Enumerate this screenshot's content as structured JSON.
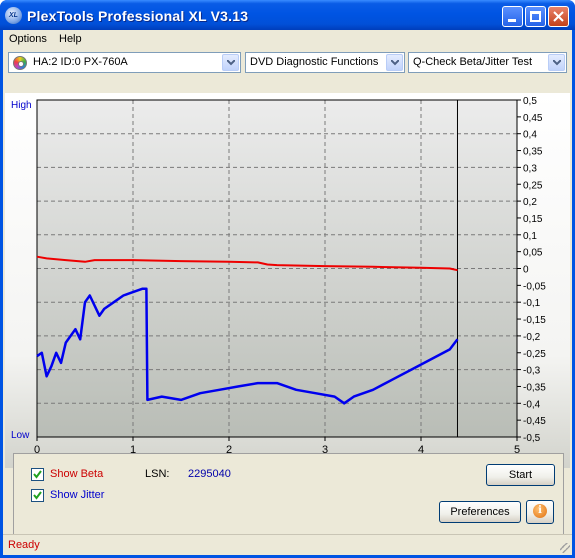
{
  "window": {
    "title": "PlexTools Professional XL V3.13",
    "icon_text": "XL"
  },
  "menu": [
    "Options",
    "Help"
  ],
  "toolbar": {
    "drive": "HA:2 ID:0  PX-760A",
    "function": "DVD Diagnostic Functions",
    "test": "Q-Check Beta/Jitter Test"
  },
  "chart_axis_labels": {
    "high": "High",
    "low": "Low"
  },
  "chart_data": {
    "type": "line",
    "xlim": [
      0,
      5
    ],
    "x_ticks": [
      "0",
      "1",
      "2",
      "3",
      "4",
      "5"
    ],
    "ylim_right": [
      -0.5,
      0.5
    ],
    "y_ticks_right": [
      "0,5",
      "0,45",
      "0,4",
      "0,35",
      "0,3",
      "0,25",
      "0,2",
      "0,15",
      "0,1",
      "0,05",
      "0",
      "-0,05",
      "-0,1",
      "-0,15",
      "-0,2",
      "-0,25",
      "-0,3",
      "-0,35",
      "-0,4",
      "-0,45",
      "-0,5"
    ],
    "grid": true,
    "marker_x": 4.38,
    "series": [
      {
        "color": "#ee0000",
        "x": [
          0,
          0.1,
          0.3,
          0.5,
          0.6,
          0.8,
          1.0,
          1.5,
          2.0,
          2.3,
          2.4,
          2.5,
          3.0,
          3.5,
          4.0,
          4.3,
          4.38
        ],
        "y": [
          0.035,
          0.03,
          0.025,
          0.02,
          0.025,
          0.025,
          0.025,
          0.022,
          0.02,
          0.018,
          0.012,
          0.01,
          0.007,
          0.005,
          0.002,
          0.0,
          -0.005
        ]
      },
      {
        "color": "#0000ee",
        "x": [
          0,
          0.05,
          0.1,
          0.15,
          0.2,
          0.25,
          0.3,
          0.4,
          0.45,
          0.5,
          0.55,
          0.6,
          0.65,
          0.7,
          0.8,
          0.9,
          1.0,
          1.1,
          1.14,
          1.15,
          1.3,
          1.5,
          1.7,
          1.9,
          2.1,
          2.3,
          2.5,
          2.7,
          2.9,
          3.1,
          3.2,
          3.3,
          3.5,
          3.7,
          3.9,
          4.1,
          4.3,
          4.38
        ],
        "y": [
          -0.26,
          -0.25,
          -0.32,
          -0.29,
          -0.25,
          -0.28,
          -0.22,
          -0.18,
          -0.21,
          -0.1,
          -0.08,
          -0.11,
          -0.14,
          -0.12,
          -0.1,
          -0.08,
          -0.07,
          -0.06,
          -0.06,
          -0.39,
          -0.38,
          -0.39,
          -0.37,
          -0.36,
          -0.35,
          -0.34,
          -0.34,
          -0.36,
          -0.37,
          -0.38,
          -0.4,
          -0.38,
          -0.36,
          -0.33,
          -0.3,
          -0.27,
          -0.24,
          -0.21
        ]
      }
    ]
  },
  "panel": {
    "show_beta_label": "Show Beta",
    "show_beta_checked": true,
    "show_jitter_label": "Show Jitter",
    "show_jitter_checked": true,
    "lsn_label": "LSN:",
    "lsn_value": "2295040",
    "start_button": "Start",
    "preferences_button": "Preferences",
    "info_icon": "info-icon"
  },
  "status": {
    "text": "Ready"
  },
  "colors": {
    "beta": "#ee0000",
    "jitter": "#0000ee",
    "plot_bg_top": "#ececec",
    "plot_bg_bottom": "#b9bdb6"
  }
}
